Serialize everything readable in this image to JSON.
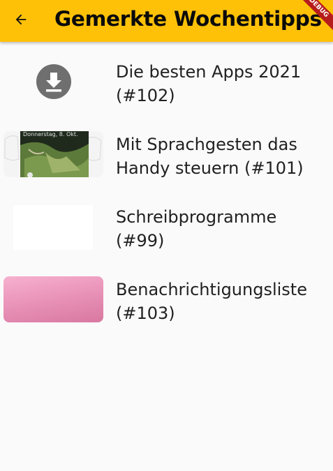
{
  "appbar": {
    "title": "Gemerkte Wochentipps",
    "back_icon": "arrow-left-icon",
    "debug_banner": "DEBUG",
    "color": "#ffc107"
  },
  "items": [
    {
      "line1": "Die besten Apps 2021",
      "line2": "(#102)",
      "thumbnail_icon": "download-icon"
    },
    {
      "line1": "Mit Sprachgesten das",
      "line2": "Handy steuern (#101)",
      "thumbnail_caption": "Donnerstag, 8. Okt."
    },
    {
      "line1": "Schreibprogramme",
      "line2": "(#99)"
    },
    {
      "line1": "Benachrichtigungsliste",
      "line2": "(#103)"
    }
  ]
}
